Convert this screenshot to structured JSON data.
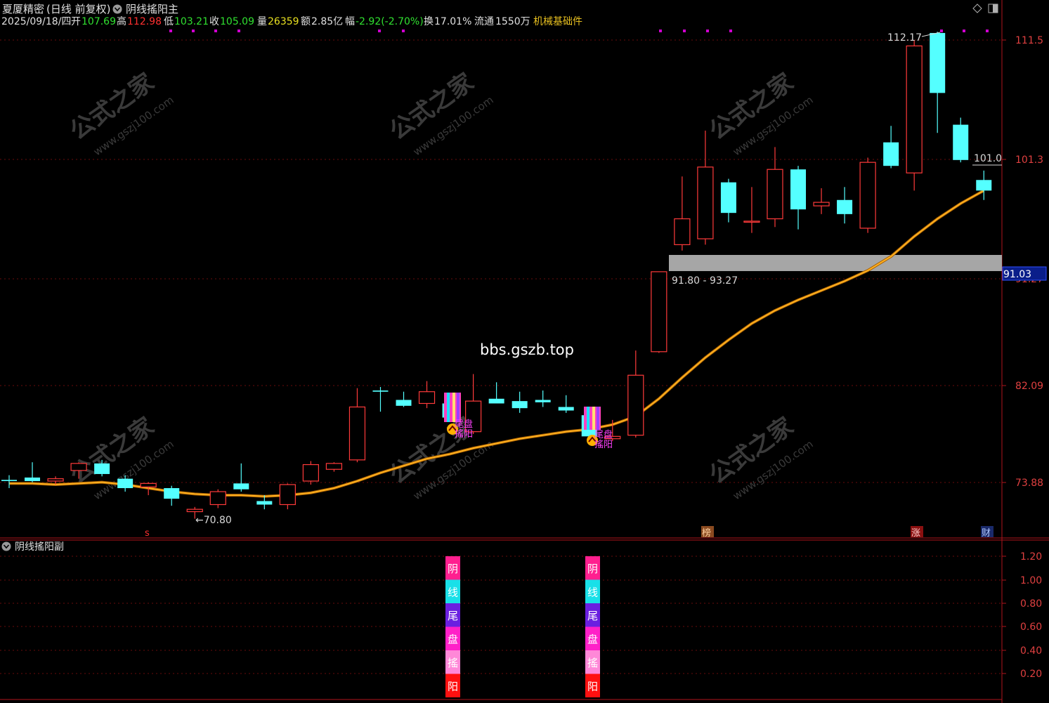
{
  "header": {
    "stock_name": "夏厦精密",
    "period_mode": "(日线 前复权)",
    "indicator_main": "阴线搖阳主",
    "date": "2025/09/18/四",
    "open_label": "开",
    "open_value": "107.69",
    "high_label": "高",
    "high_value": "112.98",
    "low_label": "低",
    "low_value": "103.21",
    "close_label": "收",
    "close_value": "105.09",
    "volume_label": "量",
    "volume_value": "26359",
    "amount_label": "额",
    "amount_value": "2.85亿",
    "change_label": "幅",
    "change_value": "-2.92(-2.70%)",
    "turnover_label": "换",
    "turnover_value": "17.01%",
    "float_label": "流通",
    "float_value": "1550万",
    "sector": "机械基础件"
  },
  "main_panel": {
    "price_axis": [
      "111.5",
      "101.3",
      "91.27",
      "82.09",
      "73.88"
    ],
    "current_price_tag": "91.03",
    "max_label": "112.17",
    "min_label": "70.80",
    "last_label": "101.0",
    "zone_label": "91.80 - 93.27",
    "watermark_site": "bbs.gszb.top",
    "watermark_text": "公式之家",
    "watermark_url": "www.gszj100.com",
    "signal_text_1": "尾盘",
    "signal_text_2": "搖阳",
    "events": {
      "s": "s",
      "bang": "榜",
      "zhang": "涨",
      "cai": "财"
    }
  },
  "sub_panel": {
    "title": "阴线搖阳副",
    "axis": [
      "1.20",
      "1.00",
      "0.80",
      "0.60",
      "0.40",
      "0.20"
    ],
    "bar_chars": [
      "阴",
      "线",
      "尾",
      "盘",
      "搖",
      "阳"
    ],
    "bar_colors": [
      "#ff1f8f",
      "#19e0e8",
      "#6a1fe0",
      "#ff20c8",
      "#ff88d8",
      "#ff1010"
    ]
  },
  "chart_data": {
    "type": "candlestick",
    "title": "",
    "ylim": [
      69,
      114
    ],
    "candles": [
      {
        "o": 74.1,
        "h": 74.5,
        "l": 73.4,
        "c": 74.0
      },
      {
        "o": 74.3,
        "h": 75.6,
        "l": 73.9,
        "c": 74.0
      },
      {
        "o": 74.0,
        "h": 74.4,
        "l": 73.7,
        "c": 74.2
      },
      {
        "o": 74.9,
        "h": 75.6,
        "l": 74.2,
        "c": 75.5
      },
      {
        "o": 75.5,
        "h": 75.8,
        "l": 74.4,
        "c": 74.6
      },
      {
        "o": 74.2,
        "h": 74.5,
        "l": 73.1,
        "c": 73.4
      },
      {
        "o": 73.5,
        "h": 73.9,
        "l": 72.8,
        "c": 73.8
      },
      {
        "o": 73.4,
        "h": 73.6,
        "l": 71.9,
        "c": 72.5
      },
      {
        "o": 71.4,
        "h": 71.8,
        "l": 70.8,
        "c": 71.6
      },
      {
        "o": 72.0,
        "h": 73.3,
        "l": 71.7,
        "c": 73.1
      },
      {
        "o": 73.8,
        "h": 75.5,
        "l": 73.1,
        "c": 73.3
      },
      {
        "o": 72.3,
        "h": 72.8,
        "l": 71.6,
        "c": 72.0
      },
      {
        "o": 72.0,
        "h": 73.8,
        "l": 71.6,
        "c": 73.7
      },
      {
        "o": 74.0,
        "h": 75.7,
        "l": 73.7,
        "c": 75.4
      },
      {
        "o": 75.0,
        "h": 75.6,
        "l": 74.8,
        "c": 75.5
      },
      {
        "o": 75.8,
        "h": 81.9,
        "l": 75.6,
        "c": 80.3
      },
      {
        "o": 81.7,
        "h": 82.0,
        "l": 79.9,
        "c": 81.6
      },
      {
        "o": 80.9,
        "h": 81.6,
        "l": 80.3,
        "c": 80.4
      },
      {
        "o": 80.6,
        "h": 82.5,
        "l": 80.2,
        "c": 81.6
      },
      {
        "o": 80.6,
        "h": 81.2,
        "l": 79.3,
        "c": 79.4
      },
      {
        "o": 78.2,
        "h": 83.1,
        "l": 78.0,
        "c": 80.8
      },
      {
        "o": 81.0,
        "h": 82.4,
        "l": 80.7,
        "c": 80.6
      },
      {
        "o": 80.8,
        "h": 81.6,
        "l": 79.8,
        "c": 80.2
      },
      {
        "o": 80.9,
        "h": 81.7,
        "l": 80.3,
        "c": 80.7
      },
      {
        "o": 80.3,
        "h": 81.3,
        "l": 79.8,
        "c": 80.0
      },
      {
        "o": 79.6,
        "h": 79.8,
        "l": 77.6,
        "c": 77.8
      },
      {
        "o": 77.6,
        "h": 79.2,
        "l": 77.4,
        "c": 77.8
      },
      {
        "o": 77.9,
        "h": 85.1,
        "l": 77.7,
        "c": 83.0
      },
      {
        "o": 85.0,
        "h": 91.8,
        "l": 84.9,
        "c": 91.8
      },
      {
        "o": 94.1,
        "h": 99.9,
        "l": 93.6,
        "c": 96.3
      },
      {
        "o": 94.6,
        "h": 103.8,
        "l": 94.1,
        "c": 100.7
      },
      {
        "o": 99.4,
        "h": 99.7,
        "l": 96.0,
        "c": 96.8
      },
      {
        "o": 96.1,
        "h": 99.0,
        "l": 95.1,
        "c": 96.1
      },
      {
        "o": 96.3,
        "h": 102.4,
        "l": 95.6,
        "c": 100.5
      },
      {
        "o": 100.5,
        "h": 100.8,
        "l": 95.4,
        "c": 97.1
      },
      {
        "o": 97.4,
        "h": 98.9,
        "l": 96.7,
        "c": 97.7
      },
      {
        "o": 97.9,
        "h": 99.0,
        "l": 95.9,
        "c": 96.7
      },
      {
        "o": 95.5,
        "h": 101.5,
        "l": 95.1,
        "c": 101.1
      },
      {
        "o": 102.8,
        "h": 104.2,
        "l": 100.6,
        "c": 100.8
      },
      {
        "o": 100.2,
        "h": 111.5,
        "l": 98.7,
        "c": 111.0
      },
      {
        "o": 112.1,
        "h": 112.2,
        "l": 103.6,
        "c": 107.0
      },
      {
        "o": 104.3,
        "h": 104.9,
        "l": 101.1,
        "c": 101.3
      },
      {
        "o": 99.6,
        "h": 100.4,
        "l": 97.9,
        "c": 98.7
      }
    ],
    "ma_line": [
      73.8,
      73.8,
      73.7,
      73.8,
      73.9,
      73.7,
      73.4,
      73.1,
      72.9,
      72.8,
      72.8,
      72.7,
      72.8,
      73.0,
      73.4,
      74.0,
      74.7,
      75.3,
      75.9,
      76.3,
      76.8,
      77.2,
      77.6,
      77.9,
      78.2,
      78.4,
      78.8,
      79.5,
      81.0,
      82.8,
      84.5,
      86.0,
      87.4,
      88.5,
      89.4,
      90.2,
      91.0,
      91.9,
      93.1,
      94.8,
      96.3,
      97.6,
      98.7
    ]
  }
}
